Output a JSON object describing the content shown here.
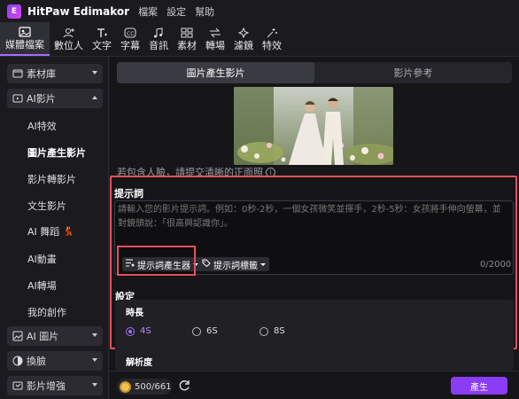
{
  "app": {
    "name": "HitPaw Edimakor",
    "logo_letter": "E"
  },
  "menu": [
    "檔案",
    "設定",
    "幫助"
  ],
  "toolbar": [
    {
      "label": "媒體檔案",
      "icon": "media-icon",
      "active": true
    },
    {
      "label": "數位人",
      "icon": "digital-human-icon"
    },
    {
      "label": "文字",
      "icon": "text-icon"
    },
    {
      "label": "字幕",
      "icon": "caption-icon"
    },
    {
      "label": "音訊",
      "icon": "music-icon"
    },
    {
      "label": "素材",
      "icon": "assets-icon"
    },
    {
      "label": "轉場",
      "icon": "transition-icon"
    },
    {
      "label": "濾鏡",
      "icon": "filter-icon"
    },
    {
      "label": "特效",
      "icon": "effects-icon"
    }
  ],
  "sidebar": {
    "groups": [
      {
        "label": "素材庫",
        "icon": "library-icon",
        "expanded": false
      },
      {
        "label": "AI影片",
        "icon": "ai-video-icon",
        "expanded": true
      },
      {
        "label": "AI 圖片",
        "icon": "ai-image-icon",
        "expanded": false
      },
      {
        "label": "換臉",
        "icon": "face-swap-icon",
        "expanded": false
      },
      {
        "label": "影片增強",
        "icon": "enhance-icon",
        "expanded": false
      }
    ],
    "ai_video_items": [
      {
        "label": "AI特效"
      },
      {
        "label": "圖片產生影片",
        "active": true
      },
      {
        "label": "影片轉影片"
      },
      {
        "label": "文生影片"
      },
      {
        "label": "AI 舞蹈",
        "emoji": "💃"
      },
      {
        "label": "AI動畫"
      },
      {
        "label": "AI轉場"
      },
      {
        "label": "我的創作"
      }
    ]
  },
  "tabs": [
    {
      "label": "圖片產生影片",
      "active": true
    },
    {
      "label": "影片參考",
      "active": false
    }
  ],
  "warning": "若包含人臉，請提交清晰的正面照",
  "prompt": {
    "label": "提示詞",
    "placeholder": "請輸入您的影片提示詞。例如：0秒-2秒，一個女孩微笑並揮手，2秒-5秒：女孩將手伸向螢幕，並對鏡頭說：「很高興認識你」。",
    "value": "",
    "generator_button": "提示詞產生器",
    "tags_button": "提示詞標籤",
    "counter": "0/2000"
  },
  "settings": {
    "label": "設定",
    "duration_label": "時長",
    "durations": [
      {
        "label": "4S",
        "selected": true
      },
      {
        "label": "6S",
        "selected": false
      },
      {
        "label": "8S",
        "selected": false
      }
    ],
    "resolution_label": "解析度"
  },
  "footer": {
    "credits": "500/661",
    "generate_label": "產生"
  },
  "colors": {
    "accent": "#8b3cf7",
    "highlight": "#e3505a",
    "coin": "#f0c24b"
  }
}
